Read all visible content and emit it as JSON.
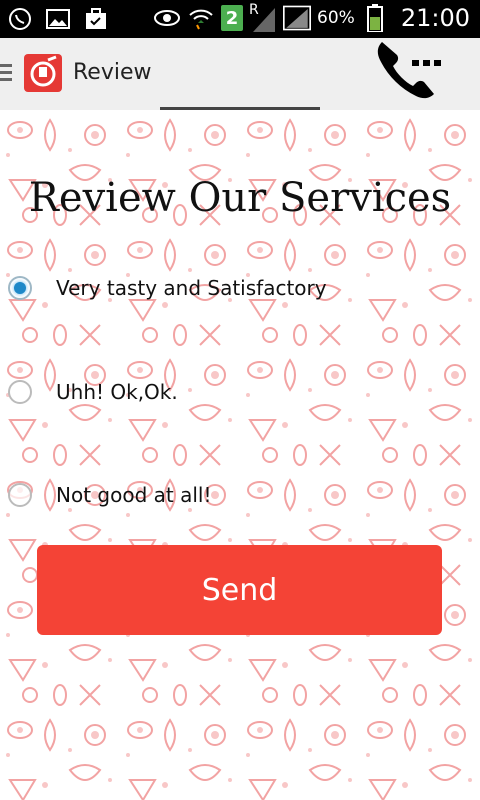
{
  "status_bar": {
    "signal_badge": "2",
    "roaming": "R",
    "battery_percent": "60%",
    "time": "21:00"
  },
  "action_bar": {
    "title": "Review"
  },
  "main": {
    "heading": "Review Our Services",
    "options": [
      {
        "label": "Very tasty and Satisfactory",
        "checked": true
      },
      {
        "label": "Uhh! Ok,Ok.",
        "checked": false
      },
      {
        "label": "Not good at all!",
        "checked": false
      }
    ],
    "send_label": "Send"
  },
  "colors": {
    "accent": "#f44336",
    "radio_selected": "#1e88c8",
    "pattern": "#f2a3a3"
  }
}
